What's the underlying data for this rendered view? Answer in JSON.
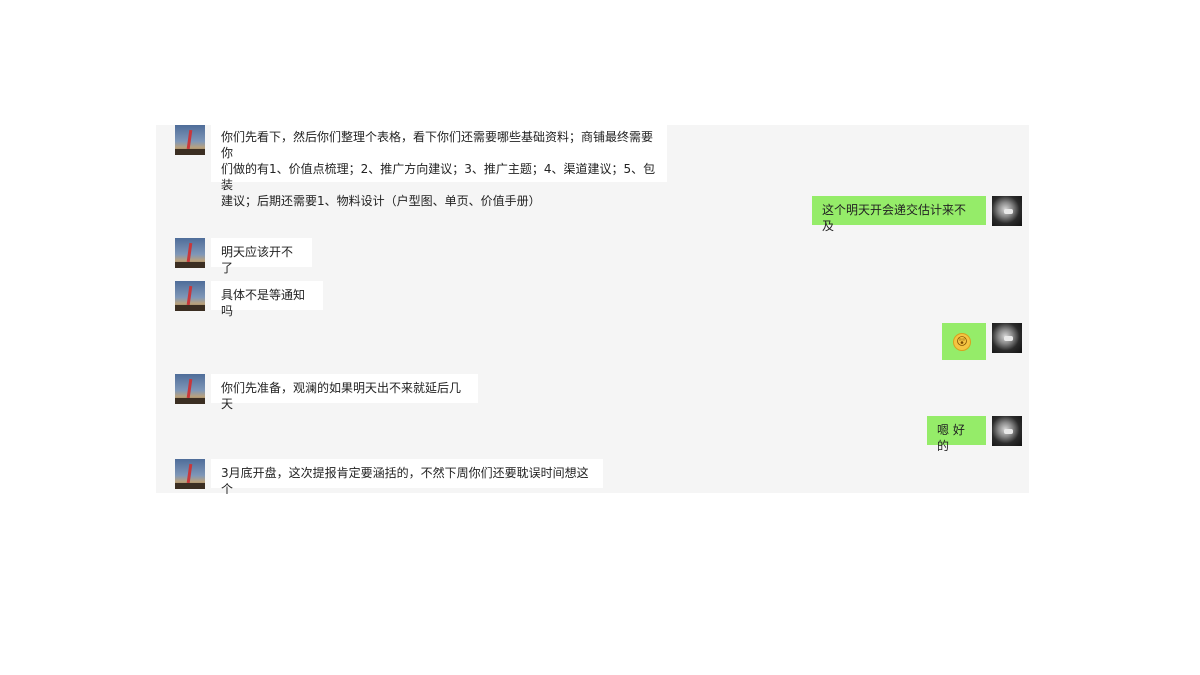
{
  "messages": [
    {
      "side": "in",
      "text": "你们先看下，然后你们整理个表格，看下你们还需要哪些基础资料；商铺最终需要你\n们做的有1、价值点梳理；2、推广方向建议；3、推广主题；4、渠道建议；5、包装\n建议；后期还需要1、物料设计（户型图、单页、价值手册）"
    },
    {
      "side": "out",
      "text": "这个明天开会递交估计来不及"
    },
    {
      "side": "in",
      "text": "明天应该开不了"
    },
    {
      "side": "in",
      "text": "具体不是等通知吗"
    },
    {
      "side": "out",
      "text": "",
      "emoji": "😲"
    },
    {
      "side": "in",
      "text": "你们先准备，观澜的如果明天出不来就延后几天"
    },
    {
      "side": "out",
      "text": "嗯 好的"
    },
    {
      "side": "in",
      "text": "3月底开盘，这次提报肯定要涵括的，不然下周你们还要耽误时间想这个"
    }
  ],
  "colors": {
    "panel_background": "#f5f5f5",
    "incoming_bubble": "#ffffff",
    "outgoing_bubble": "#95ec69"
  }
}
